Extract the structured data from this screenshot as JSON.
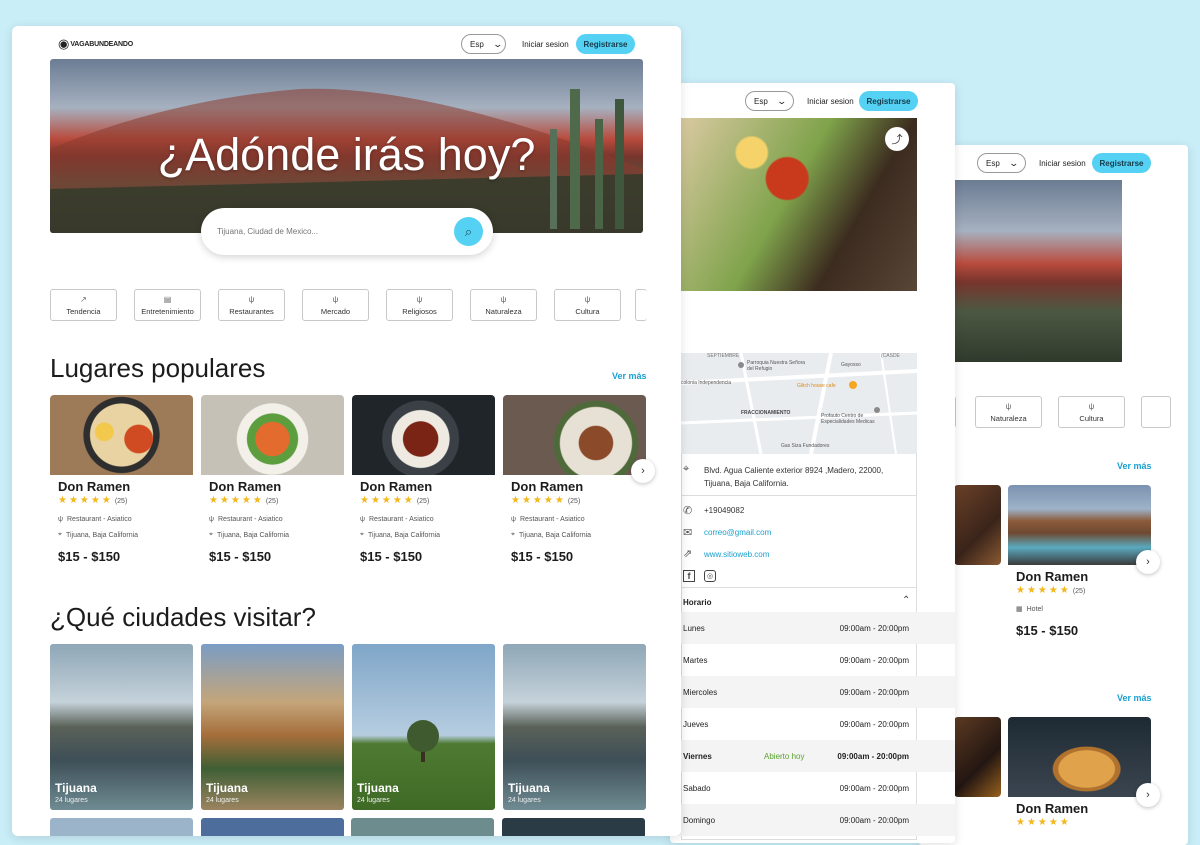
{
  "main": {
    "logo": "VAGABUNDEANDO",
    "lang": "Esp",
    "login": "Iniciar sesion",
    "register": "Registrarse",
    "hero_title": "¿Adónde irás hoy?",
    "search_placeholder": "Tijuana, Ciudad de Mexico...",
    "categories": [
      "Tendencia",
      "Entretenimiento",
      "Restaurantes",
      "Mercado",
      "Religiosos",
      "Naturaleza",
      "Cultura"
    ],
    "popular_title": "Lugares populares",
    "ver_mas": "Ver más",
    "places": [
      {
        "name": "Don Ramen",
        "count": "(25)",
        "type": "Restaurant - Asiatico",
        "location": "Tijuana, Baja California",
        "price": "$15 - $150"
      },
      {
        "name": "Don Ramen",
        "count": "(25)",
        "type": "Restaurant - Asiatico",
        "location": "Tijuana, Baja California",
        "price": "$15 - $150"
      },
      {
        "name": "Don Ramen",
        "count": "(25)",
        "type": "Restaurant - Asiatico",
        "location": "Tijuana, Baja California",
        "price": "$15 - $150"
      },
      {
        "name": "Don Ramen",
        "count": "(25)",
        "type": "Restaurant - Asiatico",
        "location": "Tijuana, Baja California",
        "price": "$15 - $150"
      }
    ],
    "cities_title": "¿Qué ciudades visitar?",
    "cities": [
      {
        "name": "Tijuana",
        "sub": "24 lugares"
      },
      {
        "name": "Tijuana",
        "sub": "24 lugares"
      },
      {
        "name": "Tijuana",
        "sub": "24 lugares"
      },
      {
        "name": "Tijuana",
        "sub": "24 lugares"
      }
    ]
  },
  "detail": {
    "lang": "Esp",
    "login": "Iniciar sesion",
    "register": "Registrarse",
    "map_labels": {
      "street1": "SEPTIEMBRE",
      "parish": "Parroquia Nuestra Señora del Refugio",
      "gayosso": "Gayosso",
      "area1": "colonia Independencia",
      "cafe": "Glitch house cafe",
      "district": "FRACCIONAMIENTO",
      "health": "Profauto Centro de Especialidades Medicas",
      "store": "Gas Siza Fundadores",
      "street2": "(CASDE"
    },
    "address": "Blvd. Agua Caliente exterior 8924 ,Madero, 22000, Tijuana, Baja California.",
    "phone": "+19049082",
    "email": "correo@gmail.com",
    "web": "www.sitioweb.com",
    "horario": "Horario",
    "schedule": [
      {
        "day": "Lunes",
        "hours": "09:00am - 20:00pm"
      },
      {
        "day": "Martes",
        "hours": "09:00am - 20:00pm"
      },
      {
        "day": "Miercoles",
        "hours": "09:00am - 20:00pm"
      },
      {
        "day": "Jueves",
        "hours": "09:00am - 20:00pm"
      },
      {
        "day": "Viernes",
        "hours": "09:00am - 20:00pm",
        "status": "Abierto hoy"
      },
      {
        "day": "Sabado",
        "hours": "09:00am - 20:00pm"
      },
      {
        "day": "Domingo",
        "hours": "09:00am - 20:00pm"
      }
    ]
  },
  "third": {
    "lang": "Esp",
    "login": "Iniciar sesion",
    "register": "Registrarse",
    "categories": [
      "Naturaleza",
      "Cultura"
    ],
    "ver_mas": "Ver más",
    "card1": {
      "name": "Don Ramen",
      "count": "(25)",
      "type": "Hotel",
      "price": "$15 - $150"
    },
    "card2": {
      "name": "Don Ramen"
    }
  },
  "colors": {
    "accent": "#54d1f3",
    "link": "#1aa0d0",
    "star": "#f2b71d",
    "background": "#c9eef8"
  }
}
